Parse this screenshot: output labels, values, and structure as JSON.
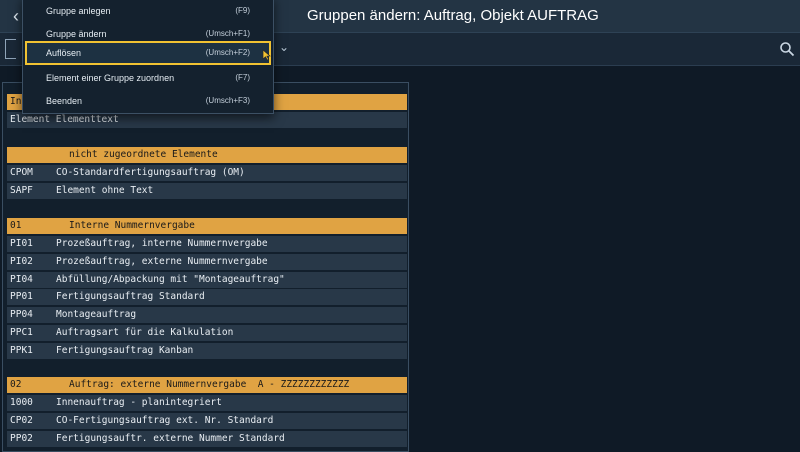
{
  "header": {
    "back_symbol": "‹",
    "title": "Gruppen ändern: Auftrag, Objekt AUFTRAG"
  },
  "toolbar": {
    "chevron": "⌄"
  },
  "menu": {
    "items": [
      {
        "label": "Gruppe anlegen",
        "shortcut": "(F9)"
      },
      {
        "label": "Gruppe ändern",
        "shortcut": "(Umsch+F1)"
      },
      {
        "label": "Auflösen",
        "shortcut": "(Umsch+F2)",
        "selected": true
      },
      {
        "label": "Element einer Gruppe zuordnen",
        "shortcut": "(F7)"
      },
      {
        "label": "Beenden",
        "shortcut": "(Umsch+F3)"
      }
    ]
  },
  "table": {
    "header_row_partial": "Int",
    "column_header": "Element Elementtext",
    "group_unassigned": "nicht zugeordnete Elemente",
    "unassigned": [
      {
        "code": "CPOM",
        "text": "CO-Standardfertigungsauftrag (OM)"
      },
      {
        "code": "SAPF",
        "text": "Element ohne Text"
      }
    ],
    "group_01": {
      "code": "01",
      "text": "Interne Nummernvergabe"
    },
    "rows_01": [
      {
        "code": "PI01",
        "text": "Prozeßauftrag, interne Nummernvergabe"
      },
      {
        "code": "PI02",
        "text": "Prozeßauftrag, externe Nummernvergabe"
      },
      {
        "code": "PI04",
        "text": "Abfüllung/Abpackung mit \"Montageauftrag\""
      },
      {
        "code": "PP01",
        "text": "Fertigungsauftrag Standard"
      },
      {
        "code": "PP04",
        "text": "Montageauftrag"
      },
      {
        "code": "PPC1",
        "text": "Auftragsart für die Kalkulation"
      },
      {
        "code": "PPK1",
        "text": "Fertigungsauftrag Kanban"
      }
    ],
    "group_02": {
      "code": "02",
      "text": "Auftrag: externe Nummernvergabe  A - ZZZZZZZZZZZZ"
    },
    "rows_02": [
      {
        "code": "1000",
        "text": "Innenauftrag - planintegriert"
      },
      {
        "code": "CP02",
        "text": "CO-Fertigungsauftrag ext. Nr. Standard"
      },
      {
        "code": "PP02",
        "text": "Fertigungsauftr. externe Nummer Standard"
      }
    ]
  },
  "colors": {
    "group_header": "#e0a343",
    "selection_border": "#f1c232",
    "background": "#0f1a26"
  }
}
